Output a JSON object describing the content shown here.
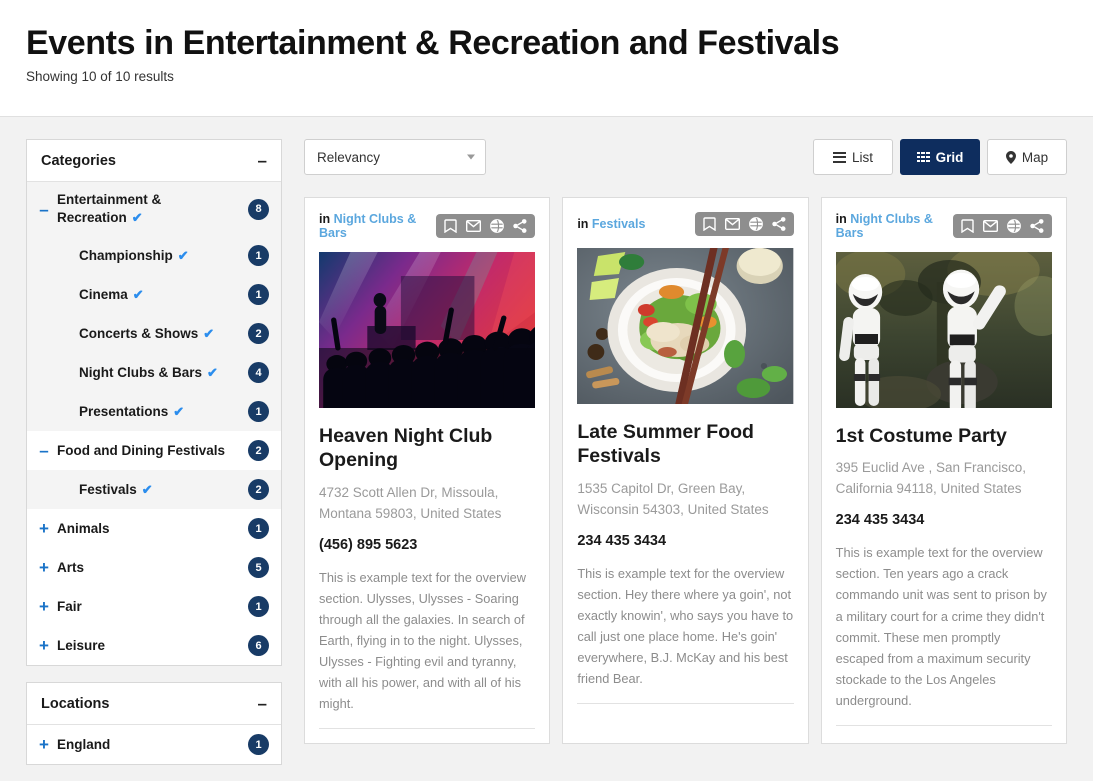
{
  "header": {
    "title": "Events in Entertainment & Recreation and Festivals",
    "results": "Showing 10 of 10 results"
  },
  "sidebar": {
    "categories_panel": {
      "title": "Categories",
      "toggle": "–",
      "items": [
        {
          "label": "Entertainment & Recreation",
          "expander": "–",
          "checked": true,
          "count": "8",
          "indent": false,
          "alt": true
        },
        {
          "label": "Championship",
          "expander": "",
          "checked": true,
          "count": "1",
          "indent": true,
          "alt": true
        },
        {
          "label": "Cinema",
          "expander": "",
          "checked": true,
          "count": "1",
          "indent": true,
          "alt": true
        },
        {
          "label": "Concerts & Shows",
          "expander": "",
          "checked": true,
          "count": "2",
          "indent": true,
          "alt": true
        },
        {
          "label": "Night Clubs & Bars",
          "expander": "",
          "checked": true,
          "count": "4",
          "indent": true,
          "alt": true
        },
        {
          "label": "Presentations",
          "expander": "",
          "checked": true,
          "count": "1",
          "indent": true,
          "alt": true
        },
        {
          "label": "Food and Dining Festivals",
          "expander": "–",
          "checked": false,
          "count": "2",
          "indent": false,
          "alt": false
        },
        {
          "label": "Festivals",
          "expander": "",
          "checked": true,
          "count": "2",
          "indent": true,
          "alt": true
        },
        {
          "label": "Animals",
          "expander": "+",
          "checked": false,
          "count": "1",
          "indent": false,
          "alt": false
        },
        {
          "label": "Arts",
          "expander": "+",
          "checked": false,
          "count": "5",
          "indent": false,
          "alt": false
        },
        {
          "label": "Fair",
          "expander": "+",
          "checked": false,
          "count": "1",
          "indent": false,
          "alt": false
        },
        {
          "label": "Leisure",
          "expander": "+",
          "checked": false,
          "count": "6",
          "indent": false,
          "alt": false
        }
      ]
    },
    "locations_panel": {
      "title": "Locations",
      "toggle": "–",
      "items": [
        {
          "label": "England",
          "expander": "+",
          "checked": false,
          "count": "1",
          "indent": false,
          "alt": false
        }
      ]
    }
  },
  "toolbar": {
    "sort_value": "Relevancy",
    "views": [
      {
        "label": "List",
        "icon": "list-icon",
        "active": false
      },
      {
        "label": "Grid",
        "icon": "grid-icon",
        "active": true
      },
      {
        "label": "Map",
        "icon": "map-pin-icon",
        "active": false
      }
    ]
  },
  "cards": [
    {
      "in_label": "in",
      "category": "Night Clubs & Bars",
      "image": "concert-crowd-photo",
      "title": "Heaven Night Club Opening",
      "address": "4732 Scott Allen Dr, Missoula, Montana 59803, United States",
      "phone": "(456) 895 5623",
      "description": "This is example text for the overview section. Ulysses, Ulysses - Soaring through all the galaxies. In search of Earth, flying in to the night. Ulysses, Ulysses - Fighting evil and tyranny, with all his power, and with all of his might."
    },
    {
      "in_label": "in",
      "category": "Festivals",
      "image": "food-bowl-photo",
      "title": "Late Summer Food Festivals",
      "address": "1535 Capitol Dr, Green Bay, Wisconsin 54303, United States",
      "phone": "234 435 3434",
      "description": "This is example text for the overview section. Hey there where ya goin', not exactly knowin', who says you have to call just one place home. He's goin' everywhere, B.J. McKay and his best friend Bear."
    },
    {
      "in_label": "in",
      "category": "Night Clubs & Bars",
      "image": "stormtroopers-photo",
      "title": "1st Costume Party",
      "address": "395 Euclid Ave , San Francisco, California 94118, United States",
      "phone": "234 435 3434",
      "description": "This is example text for the overview section. Ten years ago a crack commando unit was sent to prison by a military court for a crime they didn't commit. These men promptly escaped from a maximum security stockade to the Los Angeles underground."
    }
  ],
  "colors": {
    "accent_blue": "#1a73c8",
    "check_blue": "#2b8ded",
    "badge_navy": "#183b66",
    "active_navy": "#0e2d5e",
    "link_blue": "#5ba7de"
  }
}
